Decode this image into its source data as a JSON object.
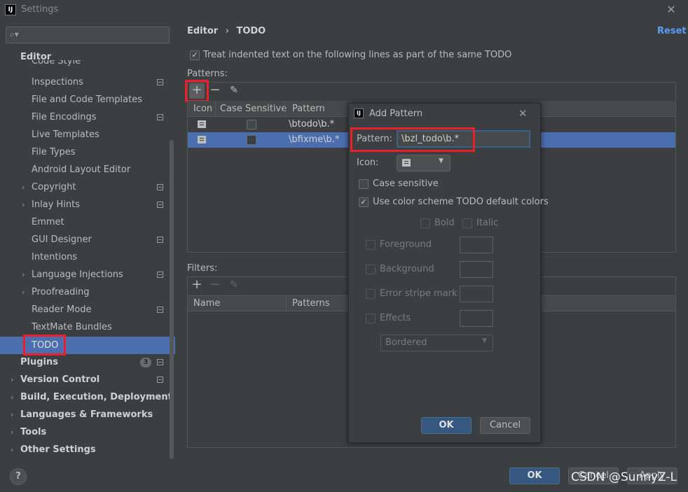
{
  "window": {
    "title": "Settings",
    "app_icon": "IJ"
  },
  "search": {
    "placeholder": ""
  },
  "sidebar": {
    "section": "Editor",
    "items": [
      {
        "label": "Code Style"
      },
      {
        "label": "Inspections"
      },
      {
        "label": "File and Code Templates"
      },
      {
        "label": "File Encodings"
      },
      {
        "label": "Live Templates"
      },
      {
        "label": "File Types"
      },
      {
        "label": "Android Layout Editor"
      },
      {
        "label": "Copyright"
      },
      {
        "label": "Inlay Hints"
      },
      {
        "label": "Emmet"
      },
      {
        "label": "GUI Designer"
      },
      {
        "label": "Intentions"
      },
      {
        "label": "Language Injections"
      },
      {
        "label": "Proofreading"
      },
      {
        "label": "Reader Mode"
      },
      {
        "label": "TextMate Bundles"
      },
      {
        "label": "TODO"
      }
    ],
    "top_items": [
      {
        "label": "Plugins",
        "badge": "3"
      },
      {
        "label": "Version Control"
      },
      {
        "label": "Build, Execution, Deployment"
      },
      {
        "label": "Languages & Frameworks"
      },
      {
        "label": "Tools"
      },
      {
        "label": "Other Settings"
      }
    ]
  },
  "breadcrumb": {
    "parent": "Editor",
    "sep": "›",
    "current": "TODO"
  },
  "reset_label": "Reset",
  "indent_option": {
    "label": "Treat indented text on the following lines as part of the same TODO",
    "checked": true
  },
  "patterns": {
    "label": "Patterns:",
    "columns": [
      "Icon",
      "Case Sensitive",
      "Pattern"
    ],
    "rows": [
      {
        "pattern": "\\btodo\\b.*",
        "case_sensitive": false
      },
      {
        "pattern": "\\bfixme\\b.*",
        "case_sensitive": false,
        "selected": true
      }
    ]
  },
  "filters": {
    "label": "Filters:",
    "columns": [
      "Name",
      "Patterns"
    ]
  },
  "buttons": {
    "ok": "OK",
    "cancel": "Cancel",
    "apply": "Apply"
  },
  "watermark": "CSDN @SunnyZ-L",
  "dialog": {
    "title": "Add Pattern",
    "pattern_label": "Pattern:",
    "pattern_value": "\\bzl_todo\\b.*",
    "icon_label": "Icon:",
    "case_sensitive": {
      "label": "Case sensitive",
      "checked": false
    },
    "use_default_colors": {
      "label": "Use color scheme TODO default colors",
      "checked": true
    },
    "bold_label": "Bold",
    "italic_label": "Italic",
    "foreground_label": "Foreground",
    "background_label": "Background",
    "error_stripe_label": "Error stripe mark",
    "effects_label": "Effects",
    "effects_style": "Bordered",
    "ok": "OK",
    "cancel": "Cancel"
  },
  "colors": {
    "selection": "#4b6eaf",
    "highlight": "#e8202a",
    "link": "#589df6",
    "primary_button": "#365880"
  }
}
